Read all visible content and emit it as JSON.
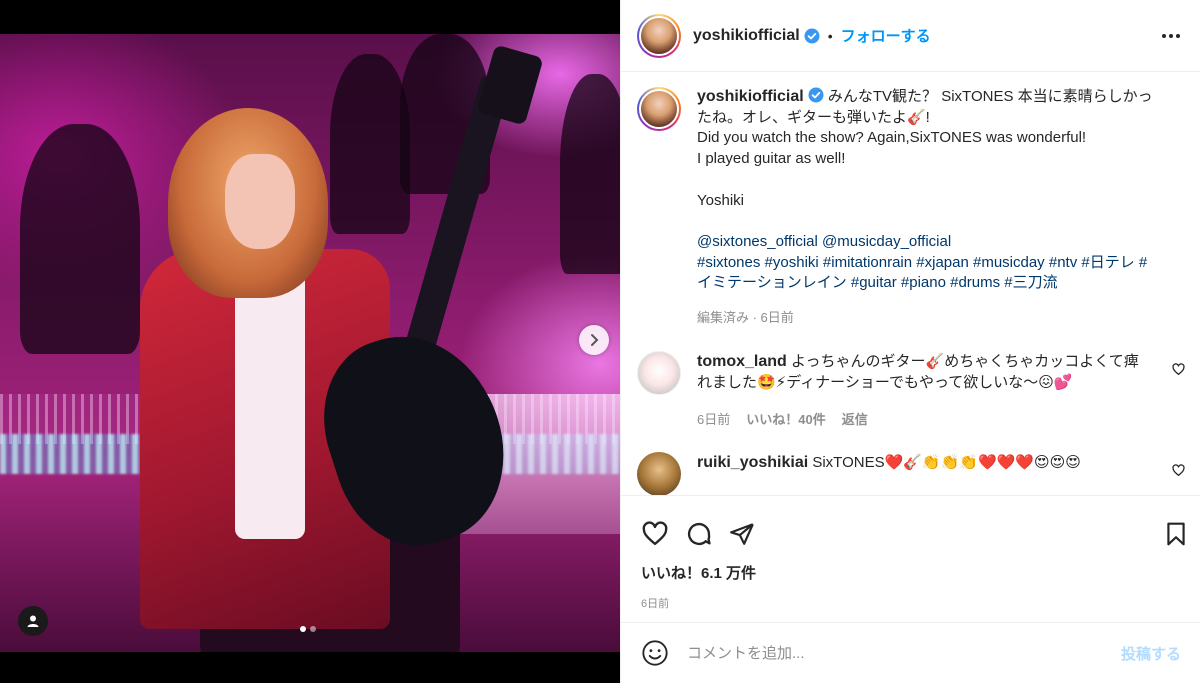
{
  "media": {
    "dots": 2,
    "active_dot": 0
  },
  "header": {
    "username": "yoshikiofficial",
    "separator": "•",
    "follow_label": "フォローする"
  },
  "caption": {
    "username": "yoshikiofficial",
    "line1": "みんなTV観た？ SixTONES 本当に素晴らしかったね。オレ、ギターも弾いたよ🎸!",
    "line2": "Did you watch the show? Again,SixTONES was wonderful!",
    "line3": "I played guitar as well!",
    "signature": "Yoshiki",
    "mentions": "@sixtones_official @musicday_official",
    "hashtags": "#sixtones #yoshiki #imitationrain #xjapan #musicday #ntv #日テレ #イミテーションレイン #guitar #piano #drums #三刀流",
    "meta": "編集済み · 6日前"
  },
  "comments": [
    {
      "username": "tomox_land",
      "text": "よっちゃんのギター🎸めちゃくちゃカッコよくて痺れました🤩⚡ディナーショーでもやって欲しいな〜😖💕",
      "time": "6日前",
      "likes": "いいね！40件",
      "reply": "返信"
    },
    {
      "username": "ruiki_yoshikiai",
      "text": "SixTONES❤️🎸👏👏👏❤️❤️❤️😍😍😍"
    }
  ],
  "actions": {
    "likes": "いいね！6.1 万件",
    "date": "6日前"
  },
  "add_comment": {
    "placeholder": "コメントを追加...",
    "post_label": "投稿する"
  },
  "colors": {
    "accent": "#0095f6",
    "link": "#00376b",
    "muted": "#8e8e8e",
    "post_disabled": "#b3dbff"
  },
  "icons": [
    "verified-badge-icon",
    "more-options-icon",
    "heart-icon",
    "comment-icon",
    "share-icon",
    "bookmark-icon",
    "emoji-icon",
    "tag-user-icon",
    "chevron-right-icon"
  ]
}
